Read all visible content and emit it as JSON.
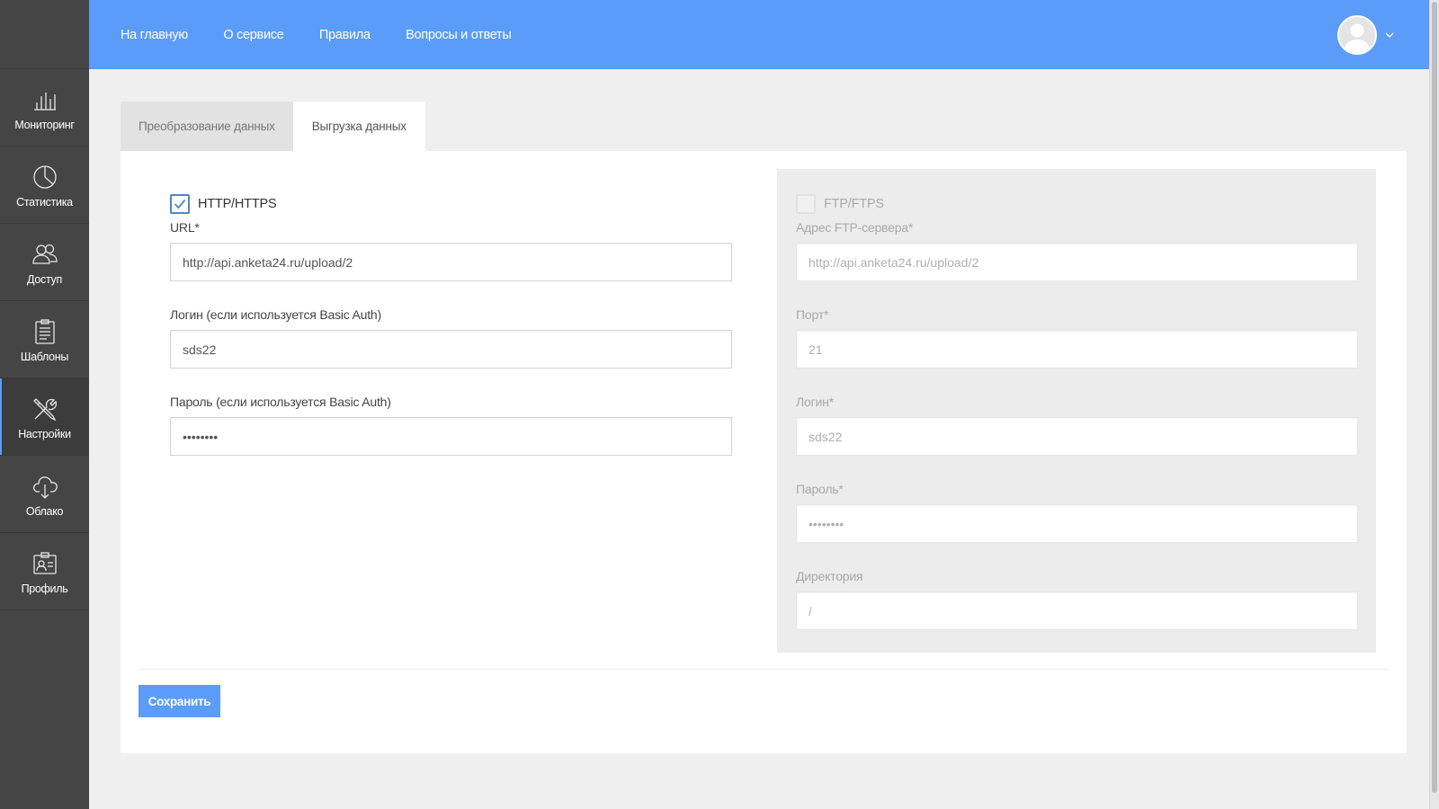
{
  "nav": {
    "items": [
      {
        "label": "На главную"
      },
      {
        "label": "О сервисе"
      },
      {
        "label": "Правила"
      },
      {
        "label": "Вопросы и ответы"
      }
    ]
  },
  "sidebar": {
    "items": [
      {
        "label": "Мониторинг",
        "icon": "bar-chart-icon"
      },
      {
        "label": "Статистика",
        "icon": "pie-chart-icon"
      },
      {
        "label": "Доступ",
        "icon": "users-icon"
      },
      {
        "label": "Шаблоны",
        "icon": "clipboard-icon"
      },
      {
        "label": "Настройки",
        "icon": "tools-icon",
        "active": true
      },
      {
        "label": "Облако",
        "icon": "cloud-download-icon"
      },
      {
        "label": "Профиль",
        "icon": "profile-card-icon"
      }
    ]
  },
  "tabs": [
    {
      "label": "Преобразование данных",
      "active": false
    },
    {
      "label": "Выгрузка данных",
      "active": true
    }
  ],
  "http": {
    "checkbox_label": "HTTP/HTTPS",
    "checked": true,
    "url_label": "URL*",
    "url_value": "http://api.anketa24.ru/upload/2",
    "login_label": "Логин (если используется Basic Auth)",
    "login_value": "sds22",
    "password_label": "Пароль (если используется Basic Auth)",
    "password_value": "••••••••"
  },
  "ftp": {
    "checkbox_label": "FTP/FTPS",
    "checked": false,
    "server_label": "Адрес FTP-сервера*",
    "server_value": "http://api.anketa24.ru/upload/2",
    "port_label": "Порт*",
    "port_value": "21",
    "login_label": "Логин*",
    "login_value": "sds22",
    "password_label": "Пароль*",
    "password_value": "••••••••",
    "directory_label": "Директория",
    "directory_value": "/"
  },
  "actions": {
    "save_label": "Сохранить"
  },
  "colors": {
    "accent": "#5a9cf7",
    "sidebar": "#454545",
    "background": "#efefef"
  }
}
